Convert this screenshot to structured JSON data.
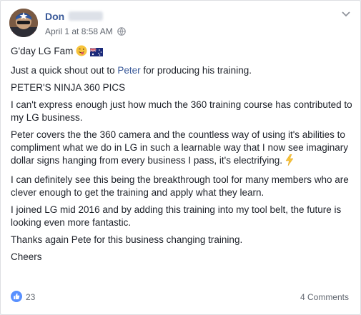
{
  "post": {
    "author": "Don",
    "timestamp": "April 1 at 8:58 AM",
    "privacy_icon": "globe-icon",
    "options_icon": "more-options-icon",
    "greeting": "G'day LG Fam",
    "greeting_emojis": [
      "winking-tongue-face-icon",
      "australia-flag-icon"
    ],
    "shout_out_prefix": "Just a quick shout out to ",
    "shout_out_mention": "Peter",
    "shout_out_suffix": " for producing his training.",
    "heading": "PETER'S NINJA 360 PICS",
    "paragraph_1": "I can't express enough just how much the 360 training course has contributed to my LG business.",
    "paragraph_2": "Peter covers the the 360 camera and the countless way of using it's abilities to compliment what we do in LG in such a learnable way that I now see imaginary dollar signs hanging from every business I pass, it's electrifying.",
    "paragraph_2_emoji": "lightning-icon",
    "paragraph_3": "I can definitely see this being the breakthrough tool for many members who are clever enough to get the training and apply what they learn.",
    "paragraph_4": "I joined LG mid 2016 and by adding this training into my tool belt, the future is looking even more fantastic.",
    "paragraph_5": "Thanks again Pete for this business changing training.",
    "sign_off": "Cheers"
  },
  "footer": {
    "reaction_icon": "like-icon",
    "like_count": "23",
    "comments": "4 Comments"
  },
  "colors": {
    "link": "#385898",
    "secondary_text": "#616770",
    "body_text": "#1d2129",
    "like_badge": "#5890ff",
    "card_border": "#dddfe2"
  }
}
